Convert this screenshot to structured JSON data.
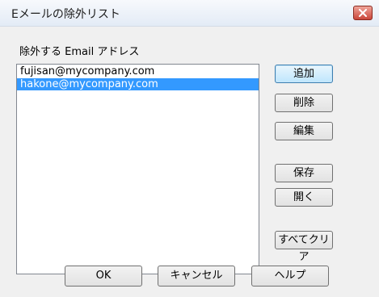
{
  "window": {
    "title": "Eメールの除外リスト",
    "close_icon": "close-icon"
  },
  "list": {
    "label": "除外する Email アドレス",
    "items": [
      "fujisan@mycompany.com",
      "hakone@mycompany.com"
    ],
    "selected_index": 1
  },
  "side_buttons": {
    "add": "追加",
    "delete": "削除",
    "edit": "編集",
    "save": "保存",
    "open": "開く",
    "clear_all": "すべてクリア"
  },
  "bottom_buttons": {
    "ok": "OK",
    "cancel": "キャンセル",
    "help": "ヘルプ"
  },
  "colors": {
    "selection": "#3399ff",
    "close_button": "#c9463a"
  }
}
